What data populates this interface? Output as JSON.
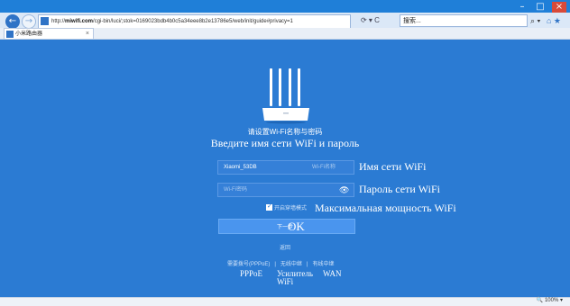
{
  "browser": {
    "url_prefix": "http://",
    "url_host": "miwifi.com",
    "url_rest": "/cgi-bin/luci/;stok=0169023bdb4b0c5a34eee8b2e13786e5/web/init/guide#privacy=1",
    "addr_tools": "⟳ ▾ C",
    "search_text": "搜索...",
    "search_icon": "⌕ ▾",
    "right_icons": "⌂ ★",
    "tab_title": "小米路由器",
    "tab_close": "×",
    "zoom": "🔍 100%  ▾"
  },
  "wincontrols": [
    "–",
    "□",
    "×"
  ],
  "page": {
    "title_cn": "请设置Wi-Fi名称与密码",
    "title_ru": "Введите имя сети WiFi и пароль",
    "wifi_name_value": "Xiaomi_53DB",
    "wifi_name_placeholder": "Wi-Fi名称",
    "wifi_name_label_ru": "Имя сети WiFi",
    "wifi_pass_placeholder": "Wi-Fi密码",
    "wifi_pass_label_ru": "Пароль сети WiFi",
    "eye_icon": "👁",
    "max_power_cn": "开启穿墙模式",
    "max_power_ru": "Максимальная мощность WiFi",
    "next_cn": "下一步",
    "next_ru": "OK",
    "back_cn": "返回",
    "links": [
      {
        "cn": "需要拨号(PPPoE)",
        "ru": "PPPoE"
      },
      {
        "cn": "无线中继",
        "ru": "Усилитель WiFi"
      },
      {
        "cn": "有线中继",
        "ru": "WAN"
      }
    ],
    "separator": "|"
  },
  "colors": {
    "background": "#2b7bd3",
    "button": "#4a95ee"
  }
}
